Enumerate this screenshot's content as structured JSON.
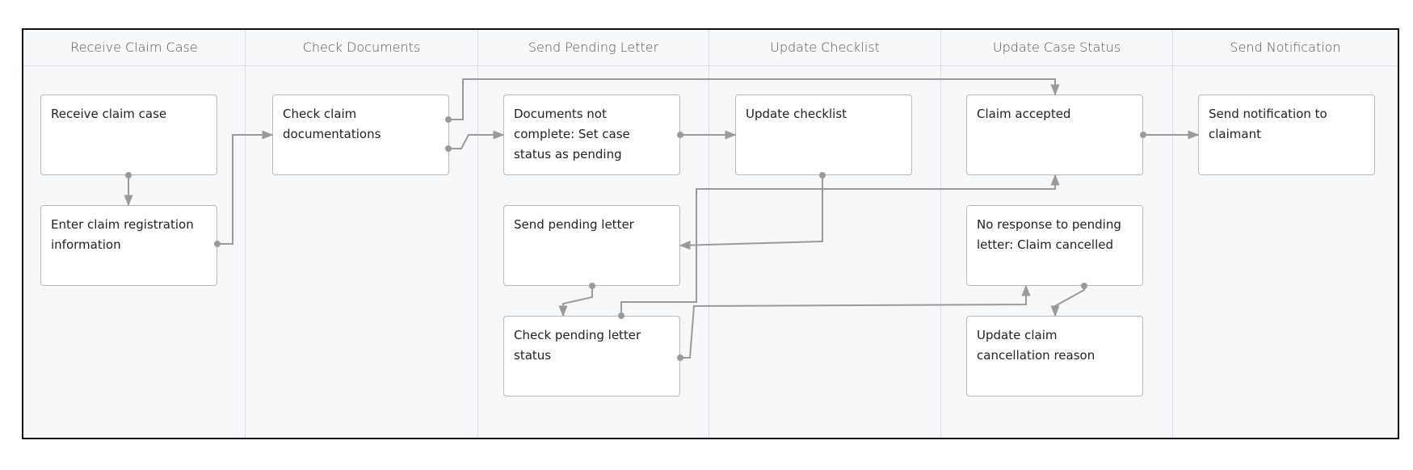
{
  "lanes": [
    "Receive Claim Case",
    "Check Documents",
    "Send Pending Letter",
    "Update Checklist",
    "Update Case Status",
    "Send Notification"
  ],
  "tasks": {
    "receive_claim_case": "Receive claim case",
    "enter_claim_info": "Enter claim registration information",
    "check_claim_docs": "Check claim documentations",
    "docs_not_complete": "Documents not complete: Set case status as pending",
    "send_pending_letter": "Send pending letter",
    "check_pending_status": "Check pending letter status",
    "update_checklist": "Update checklist",
    "claim_accepted": "Claim accepted",
    "claim_cancelled": "No response to pending letter: Claim cancelled",
    "update_cancel_reason": "Update claim cancellation reason",
    "send_notification": "Send notification to claimant"
  },
  "colors": {
    "connector": "#9a9a9a",
    "lane_divider": "#d5dde8",
    "background": "#f7f8fa"
  }
}
